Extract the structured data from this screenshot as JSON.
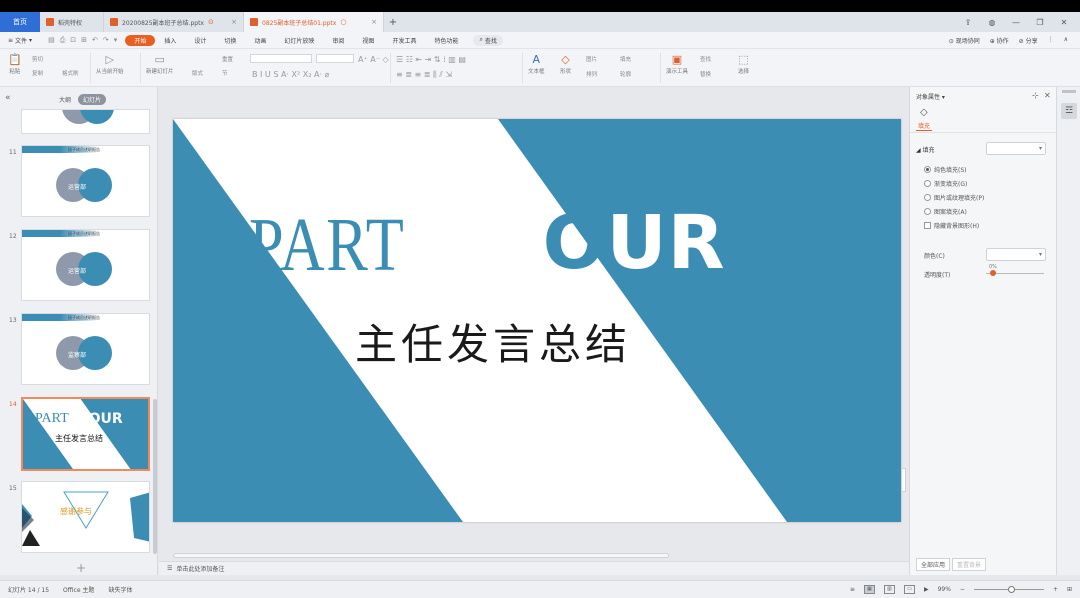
{
  "tabs": {
    "home": "首页",
    "items": [
      {
        "label": "稻壳特权",
        "status": ""
      },
      {
        "label": "20200825副本班子总结.pptx",
        "status": "⊙"
      },
      {
        "label": "0825副本班子总结01.pptx",
        "status": "○"
      }
    ],
    "new_tab": "+"
  },
  "window": {
    "cloud": "⇪",
    "skin": "◍",
    "minimize": "—",
    "restore": "❐",
    "close": "✕"
  },
  "menu": {
    "file": "文件",
    "qa": [
      "▤",
      "⎙",
      "⊡",
      "⊞",
      "↶",
      "↷",
      "▾"
    ],
    "items": [
      "开始",
      "插入",
      "设计",
      "切换",
      "动画",
      "幻灯片放映",
      "审阅",
      "视图",
      "开发工具",
      "特色功能"
    ],
    "active_index": 0,
    "search": "查找",
    "right": [
      "⊙ 现场协同",
      "⊕ 协作",
      "⊘ 分享",
      "⋮",
      "∧"
    ]
  },
  "ribbon": {
    "paste": "粘贴",
    "cut": "剪切",
    "copy": "复制",
    "format_painter": "格式刷",
    "from_current": "从当前开始",
    "new_slide": "新建幻灯片",
    "layout": "版式",
    "section": "节",
    "reset": "重置",
    "text_box": "文本框",
    "shape": "形状",
    "arrange": "排列",
    "picture": "图片",
    "fill": "填充",
    "outline": "轮廓",
    "present_tools": "演示工具",
    "find": "查找",
    "replace": "替换",
    "select": "选择"
  },
  "left_panel": {
    "collapse": "«",
    "tab_outline": "大纲",
    "tab_slides": "幻灯片",
    "thumbnails": [
      {
        "num": "",
        "label": ""
      },
      {
        "num": "11",
        "label": "运营部",
        "bar": "班子成员述职报告"
      },
      {
        "num": "12",
        "label": "运营部",
        "bar": "班子成员述职报告"
      },
      {
        "num": "13",
        "label": "监察部",
        "bar": "班子成员述职报告"
      },
      {
        "num": "14",
        "part": "PART",
        "four": "FOUR",
        "sub": "主任发言总结"
      },
      {
        "num": "15",
        "label": "感谢参与"
      }
    ],
    "add": "+"
  },
  "slide": {
    "part": "PART",
    "four_f": "F",
    "four_o": "O",
    "four_ur": "UR",
    "subtitle": "主任发言总结",
    "colors": {
      "teal": "#3b8db4",
      "white": "#ffffff"
    }
  },
  "notes": {
    "icon": "☰",
    "placeholder": "单击此处添加备注"
  },
  "right_panel": {
    "title": "对象属性 ▾",
    "pin": "⊹",
    "close": "✕",
    "fill_icon": "◇",
    "fill_tab": "填充",
    "section_fill": "◢ 填充",
    "options": [
      {
        "label": "纯色填充(S)",
        "checked": true
      },
      {
        "label": "渐变填充(G)",
        "checked": false
      },
      {
        "label": "图片或纹理填充(P)",
        "checked": false
      },
      {
        "label": "图案填充(A)",
        "checked": false
      }
    ],
    "hide_bg": "隐藏背景图形(H)",
    "color_label": "颜色(C)",
    "transparency_label": "透明度(T)",
    "transparency_value": "0%",
    "apply_all": "全部应用",
    "reset_bg": "重置背景",
    "dd_arrow": "▾"
  },
  "far_right": {
    "icon": "☲"
  },
  "status": {
    "slide_counter": "幻灯片 14 / 15",
    "theme": "Office 主题",
    "missing_font": "缺失字体",
    "zoom": "99%",
    "zoom_minus": "−",
    "zoom_plus": "+",
    "views": [
      "≡",
      "▦",
      "▥",
      "▭"
    ],
    "extra": [
      "⊞",
      "▶"
    ]
  }
}
